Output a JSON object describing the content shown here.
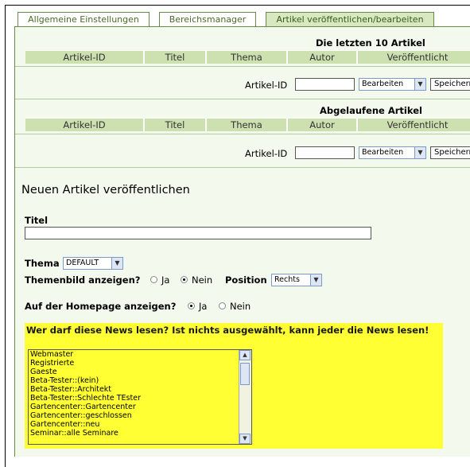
{
  "tabs": [
    {
      "label": "Allgemeine Einstellungen"
    },
    {
      "label": "Bereichsmanager"
    },
    {
      "label": "Artikel veröffentlichen/bearbeiten"
    }
  ],
  "recent": {
    "title": "Die letzten 10 Artikel",
    "columns": [
      "Artikel-ID",
      "Titel",
      "Thema",
      "Autor",
      "Veröffentlicht"
    ],
    "id_label": "Artikel-ID",
    "id_value": "",
    "action_selected": "Bearbeiten",
    "submit_label": "Speichern"
  },
  "expired": {
    "title": "Abgelaufene Artikel",
    "columns": [
      "Artikel-ID",
      "Titel",
      "Thema",
      "Autor",
      "Veröffentlicht"
    ],
    "id_label": "Artikel-ID",
    "id_value": "",
    "action_selected": "Bearbeiten",
    "submit_label": "Speichern"
  },
  "publish": {
    "heading": "Neuen Artikel veröffentlichen",
    "title_label": "Titel",
    "title_value": "",
    "topic_label": "Thema",
    "topic_selected": "DEFAULT",
    "topic_image_label": "Themenbild anzeigen?",
    "yes": "Ja",
    "no": "Nein",
    "position_label": "Position",
    "position_selected": "Rechts",
    "homepage_label": "Auf der Homepage anzeigen?",
    "readers_label": "Wer darf diese News lesen? Ist nichts ausgewählt, kann jeder die News lesen!",
    "groups": [
      "Webmaster",
      "Registrierte",
      "Gaeste",
      "Beta-Tester::(kein)",
      "Beta-Tester::Architekt",
      "Beta-Tester::Schlechte TEster",
      "Gartencenter::Gartencenter",
      "Gartencenter::geschlossen",
      "Gartencenter::neu",
      "Seminar::alle Seminare"
    ]
  },
  "icons": {
    "dropdown": "chevron-down-icon",
    "scroll_up": "arrow-up-icon",
    "scroll_down": "arrow-down-icon",
    "radio_checked": "radio-checked",
    "radio_unchecked": "radio-unchecked"
  },
  "colors": {
    "accent_green": "#cde0b0",
    "panel_bg": "#f4f9ee",
    "tab_border": "#6a8a4a",
    "highlight_yellow": "#ffff33"
  }
}
